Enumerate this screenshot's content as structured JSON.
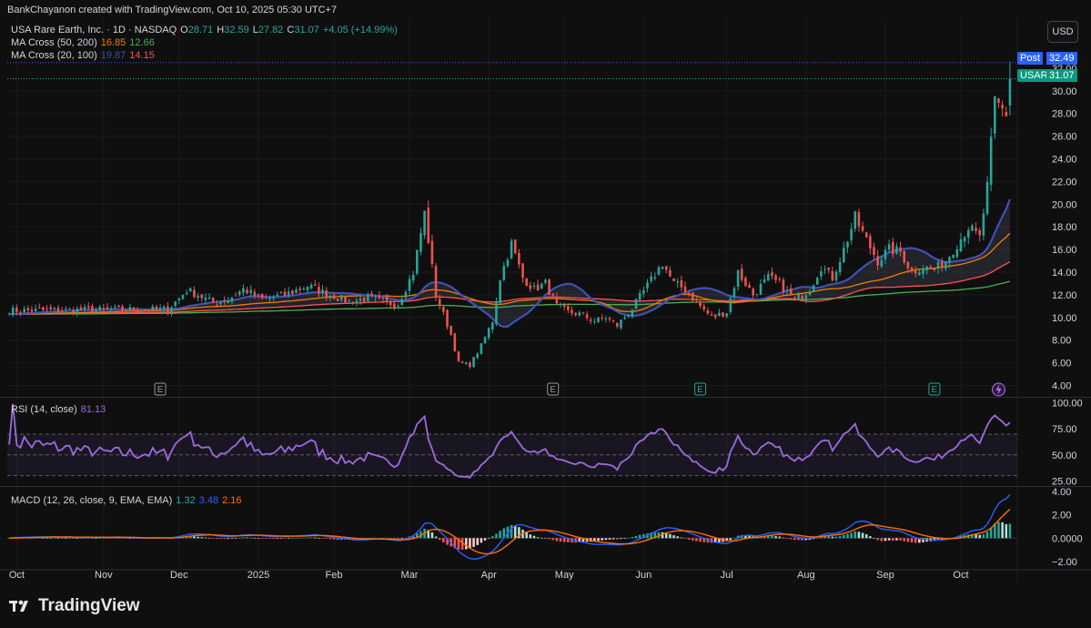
{
  "attribution": "BankChayanon created with TradingView.com, Oct 10, 2025 05:30 UTC+7",
  "currency_button": "USD",
  "legend": {
    "symbol_line": "USA Rare Earth, Inc. · 1D · NASDAQ",
    "ohlc": {
      "o_label": "O",
      "o": "28.71",
      "h_label": "H",
      "h": "32.59",
      "l_label": "L",
      "l": "27.82",
      "c_label": "C",
      "c": "31.07",
      "change": "+4.05 (+14.99%)"
    },
    "ma1": {
      "label": "MA Cross (50, 200)",
      "v1": "16.85",
      "v2": "12.66"
    },
    "ma2": {
      "label": "MA Cross (20, 100)",
      "v1": "19.87",
      "v2": "14.15"
    },
    "rsi": {
      "label": "RSI (14, close)",
      "value": "81.13"
    },
    "macd": {
      "label": "MACD (12, 26, close, 9, EMA, EMA)",
      "v1": "1.32",
      "v2": "3.48",
      "v3": "2.16"
    }
  },
  "price_tags": {
    "post_label": "Post",
    "post_value": "32.49",
    "sym_label": "USAR",
    "sym_value": "31.07",
    "top_partial": "32.00"
  },
  "earnings_marker": "E",
  "footer_logo": "TradingView",
  "colors": {
    "up": "#26a69a",
    "down": "#ef5350",
    "ma50": "#f57c00",
    "ma200": "#4caf50",
    "ma20": "#3f51b5",
    "ma100": "#ff5252",
    "rsi": "#9c6ade",
    "macd": "#2962ff",
    "signal": "#ff6d00",
    "post": "#2962ff"
  },
  "chart_data": [
    {
      "type": "candlestick",
      "pane": "price",
      "ylim": [
        3.0,
        34.0
      ],
      "y_ticks": [
        "4.00",
        "6.00",
        "8.00",
        "10.00",
        "12.00",
        "14.00",
        "16.00",
        "18.00",
        "20.00",
        "22.00",
        "24.00",
        "26.00",
        "28.00",
        "30.00"
      ],
      "x_ticks": [
        "Oct",
        "Nov",
        "Dec",
        "2025",
        "Feb",
        "Mar",
        "Apr",
        "May",
        "Jun",
        "Jul",
        "Aug",
        "Sep",
        "Oct"
      ],
      "close_anchors": [
        [
          0,
          10.6
        ],
        [
          30,
          10.7
        ],
        [
          42,
          10.7
        ],
        [
          45,
          11.7
        ],
        [
          47,
          12.4
        ],
        [
          50,
          12.0
        ],
        [
          54,
          11.3
        ],
        [
          58,
          11.6
        ],
        [
          62,
          12.5
        ],
        [
          67,
          11.6
        ],
        [
          73,
          12.0
        ],
        [
          79,
          12.8
        ],
        [
          84,
          12.1
        ],
        [
          90,
          11.4
        ],
        [
          95,
          11.7
        ],
        [
          100,
          11.3
        ],
        [
          103,
          11.2
        ],
        [
          107,
          14.0
        ],
        [
          110,
          19.2
        ],
        [
          113,
          12.0
        ],
        [
          117,
          8.5
        ],
        [
          119,
          6.0
        ],
        [
          122,
          5.8
        ],
        [
          125,
          7.5
        ],
        [
          128,
          9.7
        ],
        [
          130,
          13.5
        ],
        [
          133,
          16.5
        ],
        [
          136,
          13.5
        ],
        [
          139,
          12.5
        ],
        [
          142,
          13.0
        ],
        [
          145,
          11.0
        ],
        [
          148,
          10.5
        ],
        [
          151,
          10.3
        ],
        [
          155,
          9.7
        ],
        [
          158,
          10.0
        ],
        [
          161,
          9.3
        ],
        [
          165,
          10.8
        ],
        [
          169,
          12.8
        ],
        [
          173,
          14.8
        ],
        [
          176,
          13.0
        ],
        [
          179,
          12.5
        ],
        [
          183,
          11.0
        ],
        [
          186,
          10.0
        ],
        [
          190,
          10.5
        ],
        [
          193,
          14.0
        ],
        [
          197,
          12.0
        ],
        [
          201,
          13.5
        ],
        [
          204,
          13.0
        ],
        [
          208,
          11.5
        ],
        [
          212,
          12.5
        ],
        [
          215,
          14.5
        ],
        [
          218,
          13.5
        ],
        [
          221,
          16.0
        ],
        [
          224,
          18.8
        ],
        [
          227,
          16.8
        ],
        [
          230,
          15.0
        ],
        [
          233,
          16.0
        ],
        [
          236,
          15.8
        ],
        [
          239,
          14.0
        ],
        [
          242,
          14.5
        ],
        [
          245,
          14.2
        ],
        [
          248,
          15.0
        ],
        [
          251,
          16.5
        ],
        [
          254,
          18.0
        ],
        [
          257,
          17.0
        ],
        [
          259,
          21.5
        ],
        [
          261,
          29.0
        ],
        [
          264,
          28.0
        ],
        [
          265,
          31.07
        ]
      ],
      "bars": 266
    },
    {
      "type": "line",
      "pane": "price",
      "series": [
        {
          "name": "MA Cross (20, 100)",
          "style": "fast",
          "values_last": "19.87"
        },
        {
          "name": "MA Cross (20, 100)",
          "style": "slow",
          "values_last": "14.15"
        },
        {
          "name": "MA Cross (50, 200)",
          "style": "fast",
          "values_last": "16.85"
        },
        {
          "name": "MA Cross (50, 200)",
          "style": "slow",
          "values_last": "12.66"
        }
      ]
    },
    {
      "type": "line",
      "pane": "rsi",
      "ylim": [
        20,
        105
      ],
      "y_ticks": [
        "25.00",
        "50.00",
        "75.00",
        "100.00"
      ],
      "band": [
        30,
        70
      ],
      "last": 81.13
    },
    {
      "type": "bar",
      "pane": "macd",
      "ylim": [
        -2.4,
        4.4
      ],
      "y_ticks": [
        "−2.00",
        "0.0000",
        "2.00",
        "4.00"
      ],
      "last": {
        "histogram": 1.32,
        "macd": 3.48,
        "signal": 2.16
      }
    }
  ]
}
